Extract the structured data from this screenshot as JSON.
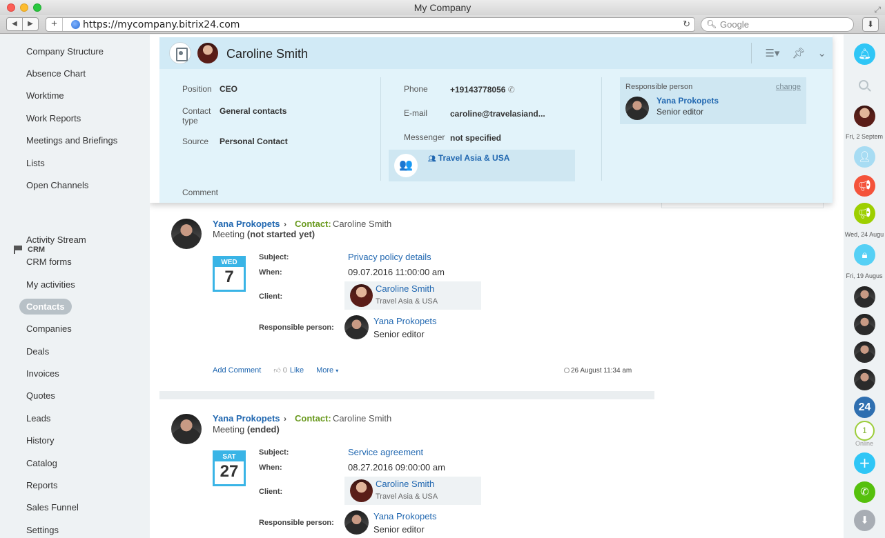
{
  "window": {
    "title": "My Company"
  },
  "browser": {
    "url": "https://mycompany.bitrix24.com",
    "search_placeholder": "Google"
  },
  "sidebar": {
    "items_top": [
      "Company Structure",
      "Absence Chart",
      "Worktime",
      "Work Reports",
      "Meetings and Briefings",
      "Lists",
      "Open Channels"
    ],
    "crm_section": "CRM",
    "crm_items": [
      "Activity Stream",
      "CRM forms",
      "My activities",
      "Contacts",
      "Companies",
      "Deals",
      "Invoices",
      "Quotes",
      "Leads",
      "History",
      "Catalog",
      "Reports",
      "Sales Funnel",
      "Settings"
    ],
    "active_item": "Contacts"
  },
  "contact_card": {
    "name": "Caroline Smith",
    "fields_left": [
      {
        "label": "Position",
        "value": "CEO"
      },
      {
        "label": "Contact type",
        "value": "General contacts"
      },
      {
        "label": "Source",
        "value": "Personal Contact"
      }
    ],
    "fields_mid": [
      {
        "label": "Phone",
        "value": "+19143778056"
      },
      {
        "label": "E-mail",
        "value": "caroline@travelasiand..."
      },
      {
        "label": "Messenger",
        "value": "not specified"
      }
    ],
    "company": "Travel Asia & USA",
    "comment_label": "Comment",
    "responsible": {
      "label": "Responsible person",
      "change": "change",
      "name": "Yana Prokopets",
      "title": "Senior editor"
    }
  },
  "feed": [
    {
      "author": "Yana Prokopets",
      "contact_label": "Contact:",
      "contact_name": "Caroline Smith",
      "type": "Meeting",
      "status": "(not started yet)",
      "cal_day": "WED",
      "cal_num": "7",
      "subject_label": "Subject:",
      "subject": "Privacy policy details",
      "when_label": "When:",
      "when": "09.07.2016 11:00:00 am",
      "client_label": "Client:",
      "client_name": "Caroline Smith",
      "client_company": "Travel Asia & USA",
      "responsible_label": "Responsible person:",
      "responsible_name": "Yana Prokopets",
      "responsible_title": "Senior editor",
      "add_comment": "Add Comment",
      "likes": "0",
      "like_label": "Like",
      "more": "More",
      "timestamp": "26 August 11:34 am"
    },
    {
      "author": "Yana Prokopets",
      "contact_label": "Contact:",
      "contact_name": "Caroline Smith",
      "type": "Meeting",
      "status": "(ended)",
      "cal_day": "SAT",
      "cal_num": "27",
      "subject_label": "Subject:",
      "subject": "Service agreement",
      "when_label": "When:",
      "when": "08.27.2016 09:00:00 am",
      "client_label": "Client:",
      "client_name": "Caroline Smith",
      "client_company": "Travel Asia & USA",
      "responsible_label": "Responsible person:",
      "responsible_name": "Yana Prokopets",
      "responsible_title": "Senior editor"
    }
  ],
  "rightbar": {
    "dates": [
      "Fri, 2 Septem",
      "Wed, 24 Augu",
      "Fri, 19 Augus"
    ],
    "badge_24": "24",
    "online_count": "1",
    "online_label": "Online",
    "colors": {
      "bell": "#2fc6f6",
      "orange": "#f4533a",
      "green": "#9dcf00",
      "blue24": "#2f6fb0",
      "phone": "#55c00c",
      "download": "#a8adb4"
    }
  }
}
